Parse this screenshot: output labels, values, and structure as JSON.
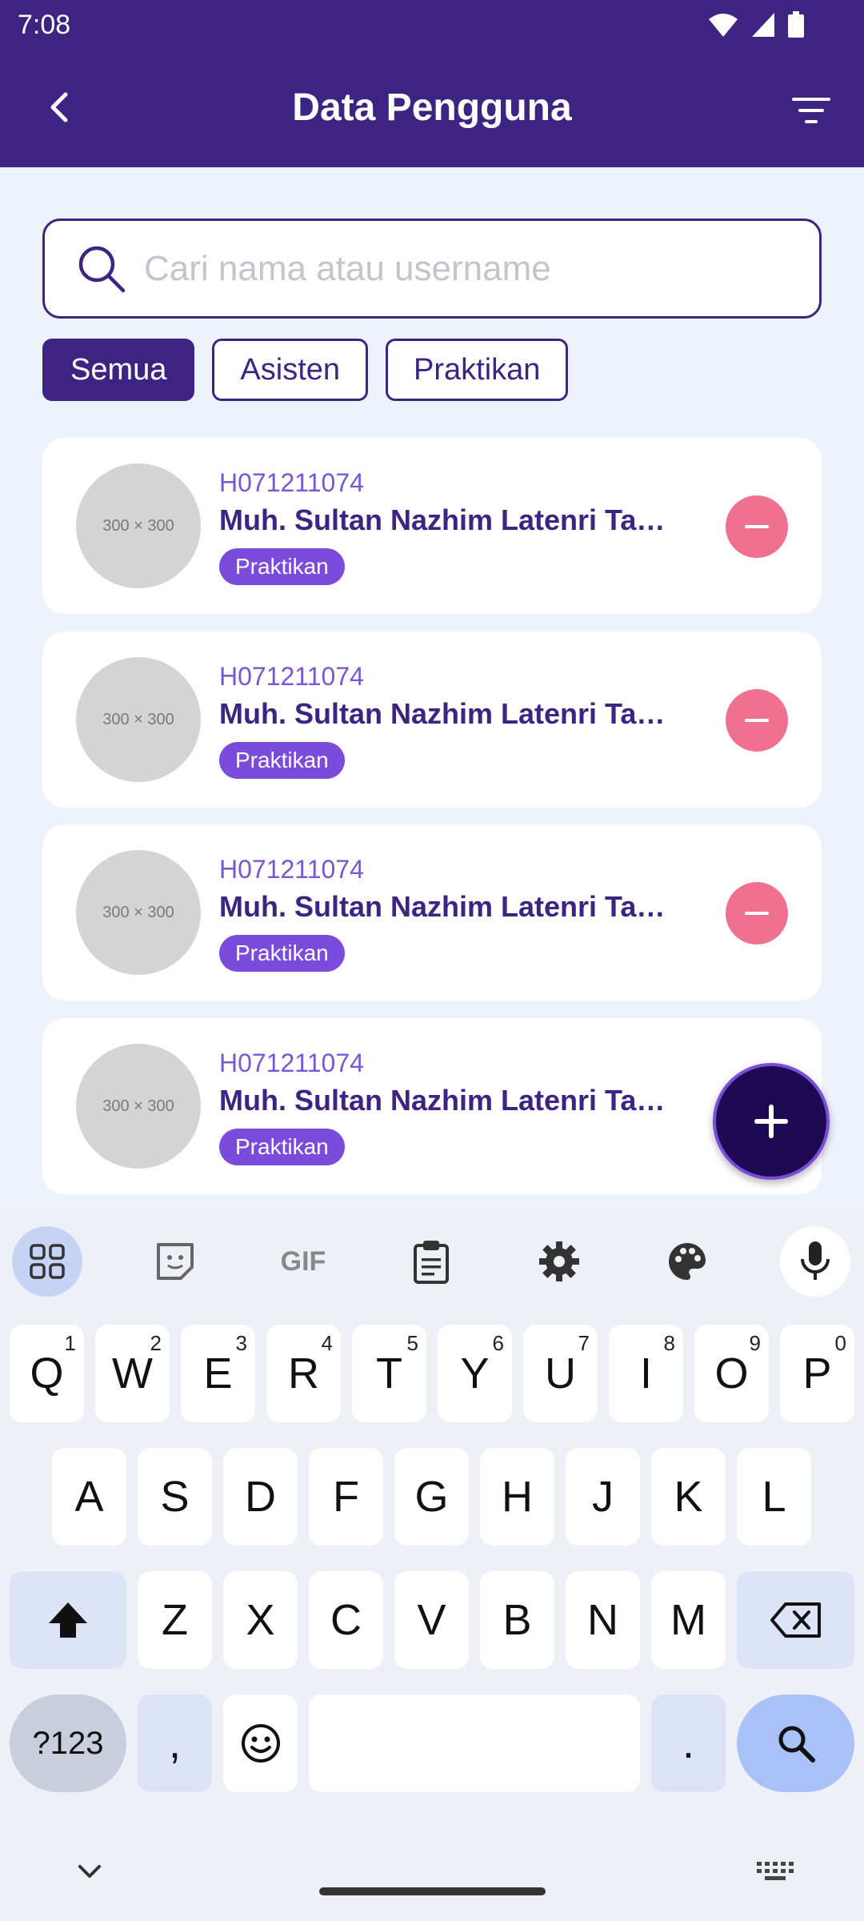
{
  "status": {
    "time": "7:08"
  },
  "header": {
    "title": "Data Pengguna"
  },
  "search": {
    "placeholder": "Cari nama atau username"
  },
  "filters": [
    {
      "label": "Semua",
      "active": true
    },
    {
      "label": "Asisten",
      "active": false
    },
    {
      "label": "Praktikan",
      "active": false
    }
  ],
  "users": [
    {
      "avatar": "300 × 300",
      "nim": "H071211074",
      "name": "Muh. Sultan Nazhim Latenri Ta…",
      "role": "Praktikan"
    },
    {
      "avatar": "300 × 300",
      "nim": "H071211074",
      "name": "Muh. Sultan Nazhim Latenri Ta…",
      "role": "Praktikan"
    },
    {
      "avatar": "300 × 300",
      "nim": "H071211074",
      "name": "Muh. Sultan Nazhim Latenri Ta…",
      "role": "Praktikan"
    },
    {
      "avatar": "300 × 300",
      "nim": "H071211074",
      "name": "Muh. Sultan Nazhim Latenri Ta…",
      "role": "Praktikan"
    }
  ],
  "keyboard": {
    "toolbar": [
      "apps-icon",
      "sticker-icon",
      "GIF",
      "clipboard-icon",
      "settings-icon",
      "palette-icon",
      "mic-icon"
    ],
    "row1": [
      {
        "k": "Q",
        "n": "1"
      },
      {
        "k": "W",
        "n": "2"
      },
      {
        "k": "E",
        "n": "3"
      },
      {
        "k": "R",
        "n": "4"
      },
      {
        "k": "T",
        "n": "5"
      },
      {
        "k": "Y",
        "n": "6"
      },
      {
        "k": "U",
        "n": "7"
      },
      {
        "k": "I",
        "n": "8"
      },
      {
        "k": "O",
        "n": "9"
      },
      {
        "k": "P",
        "n": "0"
      }
    ],
    "row2": [
      "A",
      "S",
      "D",
      "F",
      "G",
      "H",
      "J",
      "K",
      "L"
    ],
    "row3": [
      "Z",
      "X",
      "C",
      "V",
      "B",
      "N",
      "M"
    ],
    "symbols": "?123",
    "comma": ",",
    "period": "."
  },
  "colors": {
    "primary": "#3d2483",
    "accent": "#7b4bdc",
    "danger": "#f07090",
    "background": "#eef2fa"
  }
}
